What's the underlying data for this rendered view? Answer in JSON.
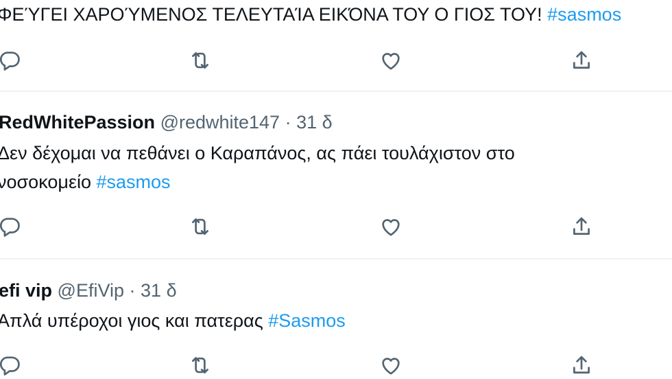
{
  "tweets": [
    {
      "text_lines": [
        {
          "text": "ΦΕΎΓΕΙ ΧΑΡΟΎΜΕΝΟΣ ΤΕΛΕΥΤΑΊΑ ΕΙΚΌΝΑ ΤΟΥ Ο ΓΙΟΣ ΤΟΥ! ",
          "hashtag": "#sasmos"
        }
      ]
    },
    {
      "author": "RedWhitePassion",
      "handle": "@redwhite147",
      "dot": "·",
      "time": "31 δ",
      "text_lines": [
        {
          "text": "Δεν δέχομαι να πεθάνει ο Καραπάνος, ας πάει τουλάχιστον στο",
          "hashtag": ""
        },
        {
          "text": "νοσοκομείο ",
          "hashtag": "#sasmos"
        }
      ]
    },
    {
      "author": "efi vip",
      "handle": "@EfiVip",
      "dot": "·",
      "time": "31 δ",
      "text_lines": [
        {
          "text": "Απλά υπέροχοι γιος και πατερας  ",
          "hashtag": "#Sasmos"
        }
      ]
    }
  ],
  "actions": {
    "reply_icon": "reply-icon",
    "retweet_icon": "retweet-icon",
    "like_icon": "heart-icon",
    "share_icon": "share-icon"
  },
  "colors": {
    "hashtag": "#1d9bf0",
    "secondary_text": "#536471",
    "divider": "#eff3f4"
  }
}
